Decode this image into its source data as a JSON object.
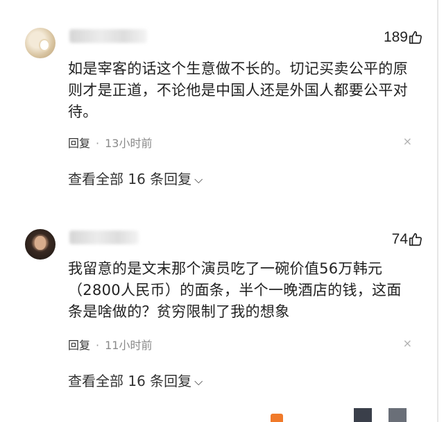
{
  "comments": [
    {
      "likes": "189",
      "text": "如是宰客的话这个生意做不长的。切记买卖公平的原则才是正道，不论他是中国人还是外国人都要公平对待。",
      "reply_label": "回复",
      "separator": "·",
      "time": "13小时前",
      "close": "×",
      "view_replies": "查看全部 16 条回复",
      "chevron": "⌵"
    },
    {
      "likes": "74",
      "text": "我留意的是文末那个演员吃了一碗价值56万韩元（2800人民币）的面条，半个一晚酒店的钱，这面条是啥做的？贫穷限制了我的想象",
      "reply_label": "回复",
      "separator": "·",
      "time": "11小时前",
      "close": "×",
      "view_replies": "查看全部 16 条回复",
      "chevron": "⌵"
    }
  ],
  "icons": {
    "like": "thumbs-up-icon",
    "close": "close-icon",
    "chevron": "chevron-down-icon"
  },
  "colors": {
    "text": "#222222",
    "muted": "#8a8a8a",
    "divider": "#e6e6e6"
  }
}
